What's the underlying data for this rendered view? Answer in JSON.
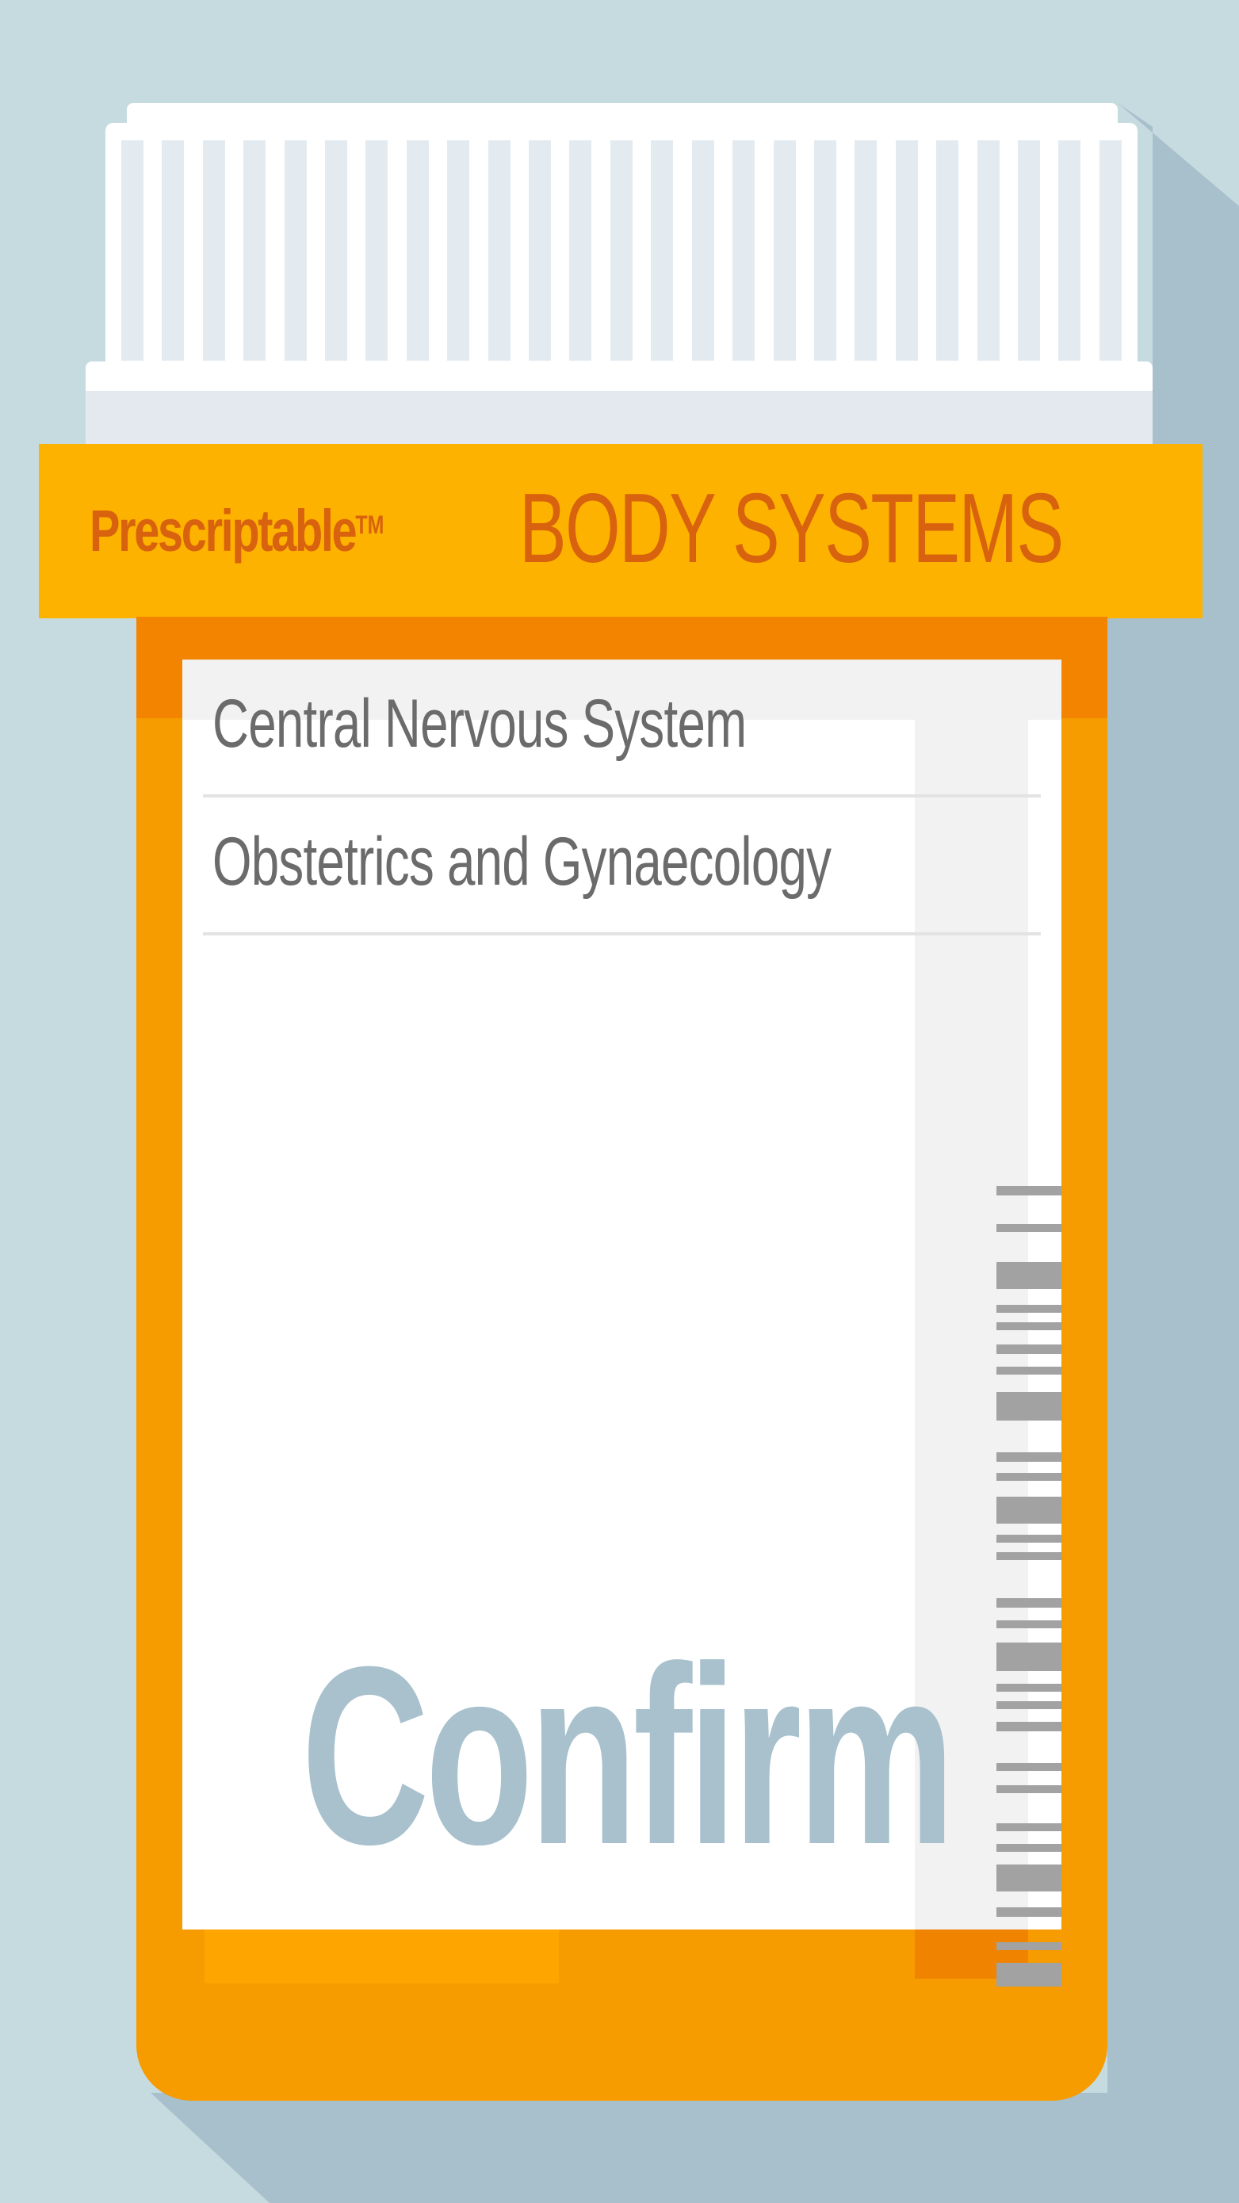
{
  "header": {
    "brand": "Prescriptable",
    "trademark": "TM",
    "title": "BODY SYSTEMS"
  },
  "menu": {
    "items": [
      {
        "label": "Central Nervous System"
      },
      {
        "label": "Obstetrics and Gynaecology"
      }
    ]
  },
  "actions": {
    "confirm_label": "Confirm"
  },
  "colors": {
    "background": "#c6dbe0",
    "shadow": "#a8bfcc",
    "band": "#fdb200",
    "bottle": "#f69b00",
    "brand_text": "#d8620d",
    "item_text": "#6b6b6b",
    "confirm_text": "#a8c1cd"
  }
}
